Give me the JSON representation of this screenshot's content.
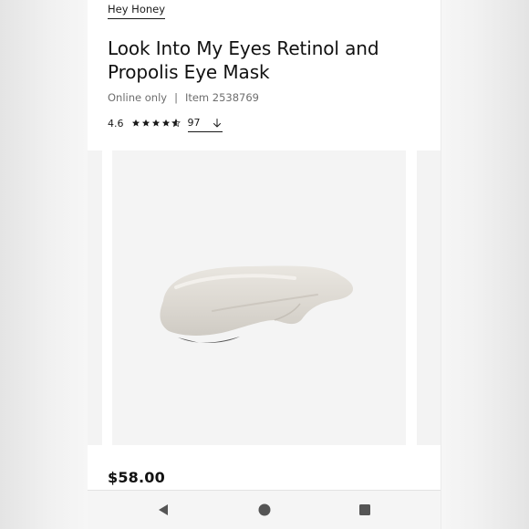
{
  "product": {
    "brand": "Hey Honey",
    "title": "Look Into My Eyes Retinol and Propolis Eye Mask",
    "availability": "Online only",
    "separator": "|",
    "item_number": "Item 2538769",
    "rating": "4.6",
    "rating_value": 4.6,
    "review_count": "97",
    "price": "$58.00"
  },
  "icons": {
    "rating_stars": "star-icon",
    "reviews_link": "arrow-down-icon",
    "nav_back": "back-triangle-icon",
    "nav_home": "home-circle-icon",
    "nav_recents": "recents-square-icon"
  },
  "colors": {
    "text": "#1a1a1a",
    "muted": "#6e6e6e",
    "image_bg": "#f4f4f4",
    "nav_icons": "#555555"
  }
}
